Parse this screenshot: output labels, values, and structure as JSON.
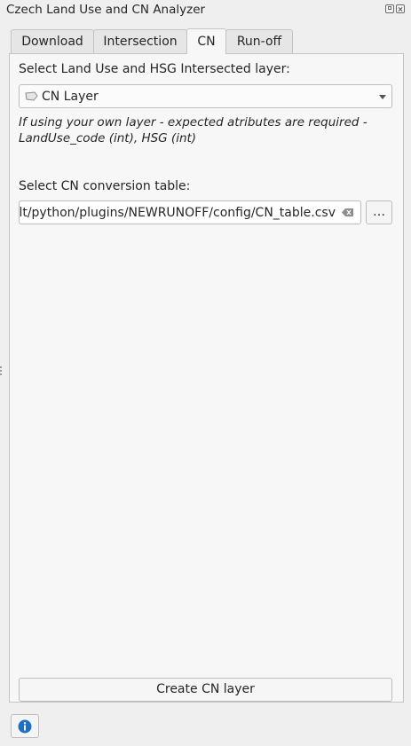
{
  "window": {
    "title": "Czech Land Use and CN Analyzer",
    "buttons": [
      "float-icon",
      "close-icon"
    ]
  },
  "tabs": [
    {
      "label": "Download",
      "active": false
    },
    {
      "label": "Intersection",
      "active": false
    },
    {
      "label": "CN",
      "active": true
    },
    {
      "label": "Run-off",
      "active": false
    }
  ],
  "cn_tab": {
    "layer_label": "Select Land Use and HSG Intersected layer:",
    "layer_combo": {
      "value": "CN Layer",
      "icon": "polygon-layer-icon"
    },
    "hint": "If using your own layer - expected atributes are required - LandUse_code (int), HSG (int)",
    "table_label": "Select CN conversion table:",
    "table_path": {
      "value": "ult/python/plugins/NEWRUNOFF/config/CN_table.csv",
      "clear_icon": "clear-icon"
    },
    "browse_label": "…",
    "create_button": "Create CN layer"
  },
  "footer": {
    "info_icon": "info-icon"
  },
  "colors": {
    "info_blue": "#1f6fc5",
    "border": "#bdbdbd",
    "background": "#efefef"
  }
}
